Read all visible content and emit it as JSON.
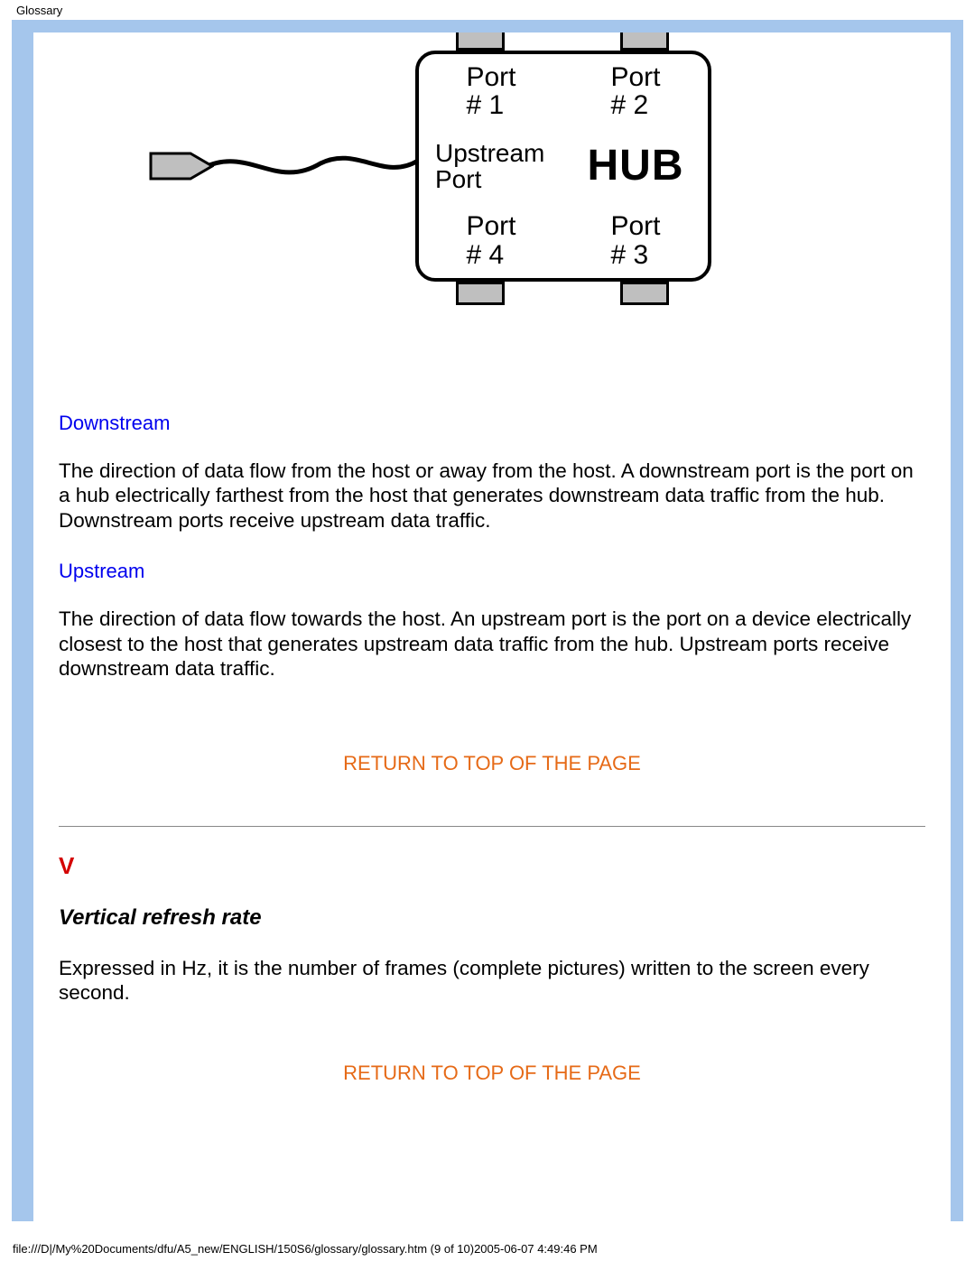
{
  "header": {
    "page_label": "Glossary"
  },
  "diagram": {
    "port1": "Port\n# 1",
    "port2": "Port\n# 2",
    "upstream_port": "Upstream\nPort",
    "hub_label": "HUB",
    "port4": "Port\n# 4",
    "port3": "Port\n# 3"
  },
  "terms": {
    "downstream": {
      "title": "Downstream",
      "body": "The direction of data flow from the host or away from the host. A downstream port is the port on a hub electrically farthest from the host that generates downstream data traffic from the hub. Downstream ports receive upstream data traffic."
    },
    "upstream": {
      "title": "Upstream",
      "body": "The direction of data flow towards the host. An upstream port is the port on a device electrically closest to the host that generates upstream data traffic from the hub. Upstream ports receive downstream data traffic."
    }
  },
  "links": {
    "return_top": "RETURN TO TOP OF THE PAGE"
  },
  "section_v": {
    "letter": "V",
    "term_title": "Vertical refresh rate",
    "body": "Expressed in Hz, it is the number of frames (complete pictures) written to the screen every second."
  },
  "footer": {
    "path": "file:///D|/My%20Documents/dfu/A5_new/ENGLISH/150S6/glossary/glossary.htm (9 of 10)2005-06-07 4:49:46 PM"
  }
}
